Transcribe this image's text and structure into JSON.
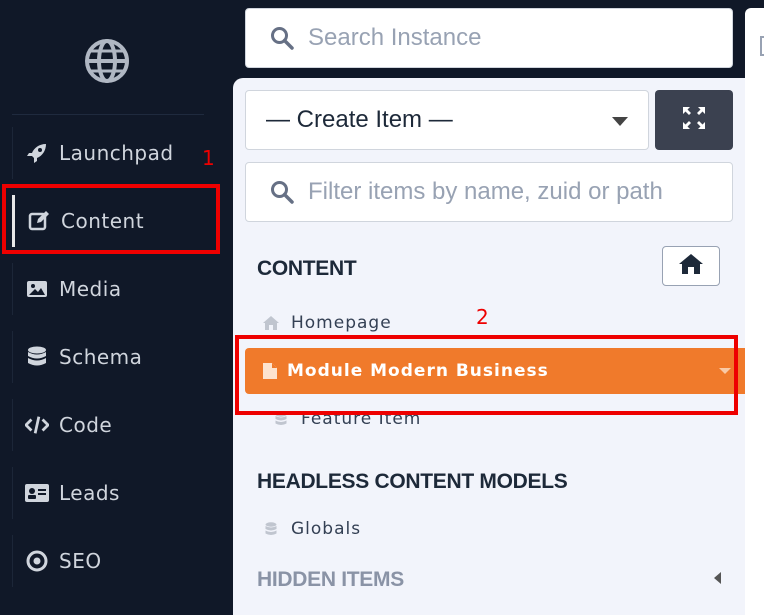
{
  "sidebar": {
    "items": [
      {
        "label": "Launchpad",
        "icon": "rocket-icon"
      },
      {
        "label": "Content",
        "icon": "edit-icon",
        "active": true
      },
      {
        "label": "Media",
        "icon": "image-icon"
      },
      {
        "label": "Schema",
        "icon": "database-icon"
      },
      {
        "label": "Code",
        "icon": "code-icon"
      },
      {
        "label": "Leads",
        "icon": "id-card-icon"
      },
      {
        "label": "SEO",
        "icon": "target-icon"
      }
    ]
  },
  "search": {
    "placeholder": "Search Instance"
  },
  "panel": {
    "create_select": "— Create Item —",
    "filter_placeholder": "Filter items by name, zuid or path",
    "content_title": "CONTENT",
    "homepage": "Homepage",
    "selected_item": "Module Modern Business",
    "feature_item": "Feature Item",
    "headless_title": "HEADLESS CONTENT MODELS",
    "globals": "Globals",
    "hidden_title": "HIDDEN ITEMS"
  },
  "annotations": {
    "one": "1",
    "two": "2"
  },
  "colors": {
    "sidebar_bg": "#101828",
    "accent": "#f07a2b",
    "annotation": "#ee0000"
  }
}
